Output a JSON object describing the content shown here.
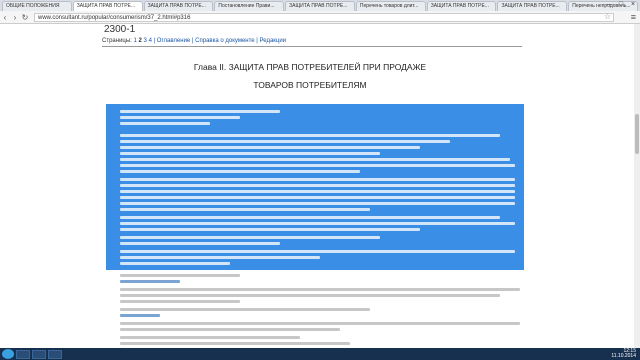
{
  "browser": {
    "tabs": [
      {
        "label": "ОБЩИЕ ПОЛОЖЕНИЯ"
      },
      {
        "label": "ЗАЩИТА ПРАВ ПОТРЕ..."
      },
      {
        "label": "ЗАЩИТА ПРАВ ПОТРЕ..."
      },
      {
        "label": "Постановление Прави..."
      },
      {
        "label": "ЗАЩИТА ПРАВ ПОТРЕ..."
      },
      {
        "label": "Перечень товаров длит..."
      },
      {
        "label": "ЗАЩИТА ПРАВ ПОТРЕ..."
      },
      {
        "label": "ЗАЩИТА ПРАВ ПОТРЕ..."
      },
      {
        "label": "Перечень непродоволь..."
      }
    ],
    "url": "www.consultant.ru/popular/consumerism/37_2.html#p316"
  },
  "doc": {
    "number": "2300-1",
    "pages_label": "Страницы:",
    "page1": "1",
    "page2": "2",
    "page3": "3",
    "page4": "4",
    "links": "| Оглавление | Справка о документе | Редакции",
    "chapter": "Глава II. ЗАЩИТА ПРАВ ПОТРЕБИТЕЛЕЙ ПРИ ПРОДАЖЕ",
    "subtitle": "ТОВАРОВ ПОТРЕБИТЕЛЯМ"
  },
  "taskbar": {
    "time": "12:15",
    "date": "11.10.2014"
  },
  "colors": {
    "selection": "#3a8ee6",
    "link": "#1a55a4"
  }
}
